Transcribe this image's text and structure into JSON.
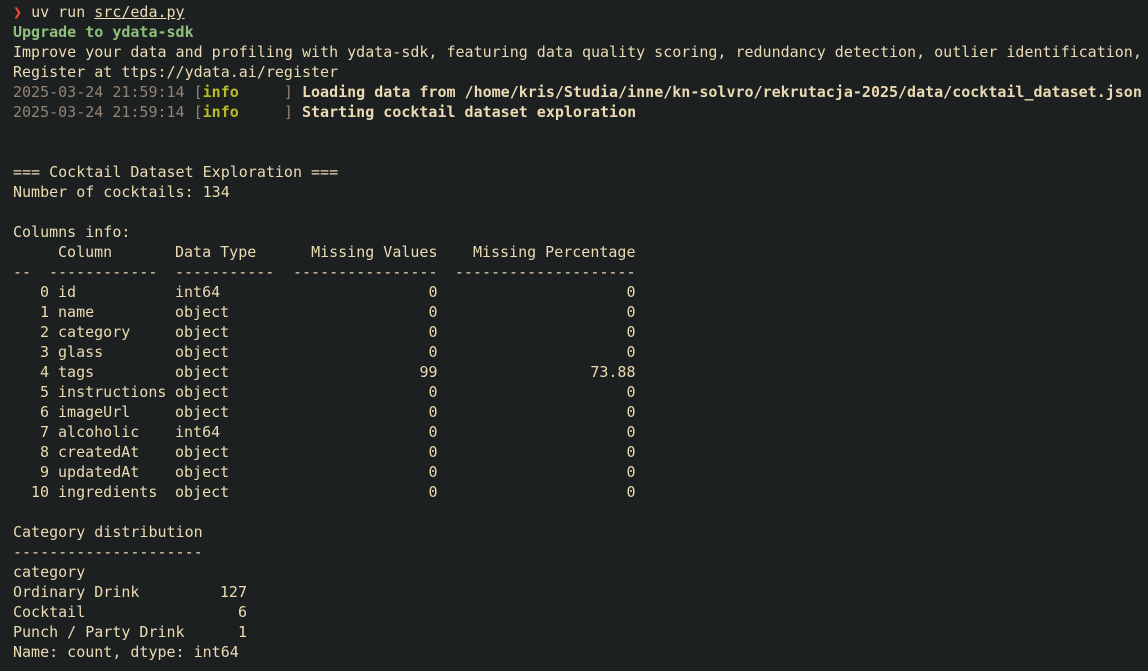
{
  "prompt": {
    "symbol": "❯",
    "command": "uv run",
    "arg": "src/eda.py"
  },
  "banner": {
    "title": "Upgrade to ydata-sdk",
    "line1": "Improve your data and profiling with ydata-sdk, featuring data quality scoring, redundancy detection, outlier identification,",
    "line2": "Register at ttps://ydata.ai/register"
  },
  "logs": [
    {
      "timestamp": "2025-03-24 21:59:14",
      "level": "info",
      "message": "Loading data from /home/kris/Studia/inne/kn-solvro/rekrutacja-2025/data/cocktail_dataset.json"
    },
    {
      "timestamp": "2025-03-24 21:59:14",
      "level": "info",
      "message": "Starting cocktail dataset exploration"
    }
  ],
  "exploration": {
    "heading": "=== Cocktail Dataset Exploration ===",
    "count_line": "Number of cocktails: 134",
    "columns_label": "Columns info:"
  },
  "columns_table": {
    "headers": [
      "",
      "Column",
      "Data Type",
      "Missing Values",
      "Missing Percentage"
    ],
    "separators": [
      "--",
      "------------",
      "-----------",
      "----------------",
      "--------------------"
    ],
    "rows": [
      {
        "idx": "0",
        "column": "id",
        "type": "int64",
        "missing": "0",
        "pct": "0"
      },
      {
        "idx": "1",
        "column": "name",
        "type": "object",
        "missing": "0",
        "pct": "0"
      },
      {
        "idx": "2",
        "column": "category",
        "type": "object",
        "missing": "0",
        "pct": "0"
      },
      {
        "idx": "3",
        "column": "glass",
        "type": "object",
        "missing": "0",
        "pct": "0"
      },
      {
        "idx": "4",
        "column": "tags",
        "type": "object",
        "missing": "99",
        "pct": "73.88"
      },
      {
        "idx": "5",
        "column": "instructions",
        "type": "object",
        "missing": "0",
        "pct": "0"
      },
      {
        "idx": "6",
        "column": "imageUrl",
        "type": "object",
        "missing": "0",
        "pct": "0"
      },
      {
        "idx": "7",
        "column": "alcoholic",
        "type": "int64",
        "missing": "0",
        "pct": "0"
      },
      {
        "idx": "8",
        "column": "createdAt",
        "type": "object",
        "missing": "0",
        "pct": "0"
      },
      {
        "idx": "9",
        "column": "updatedAt",
        "type": "object",
        "missing": "0",
        "pct": "0"
      },
      {
        "idx": "10",
        "column": "ingredients",
        "type": "object",
        "missing": "0",
        "pct": "0"
      }
    ]
  },
  "category_distribution": {
    "heading": "Category distribution",
    "rule": "---------------------",
    "index_name": "category",
    "rows": [
      {
        "name": "Ordinary Drink",
        "count": "127"
      },
      {
        "name": "Cocktail",
        "count": "6"
      },
      {
        "name": "Punch / Party Drink",
        "count": "1"
      }
    ],
    "footer": "Name: count, dtype: int64"
  }
}
